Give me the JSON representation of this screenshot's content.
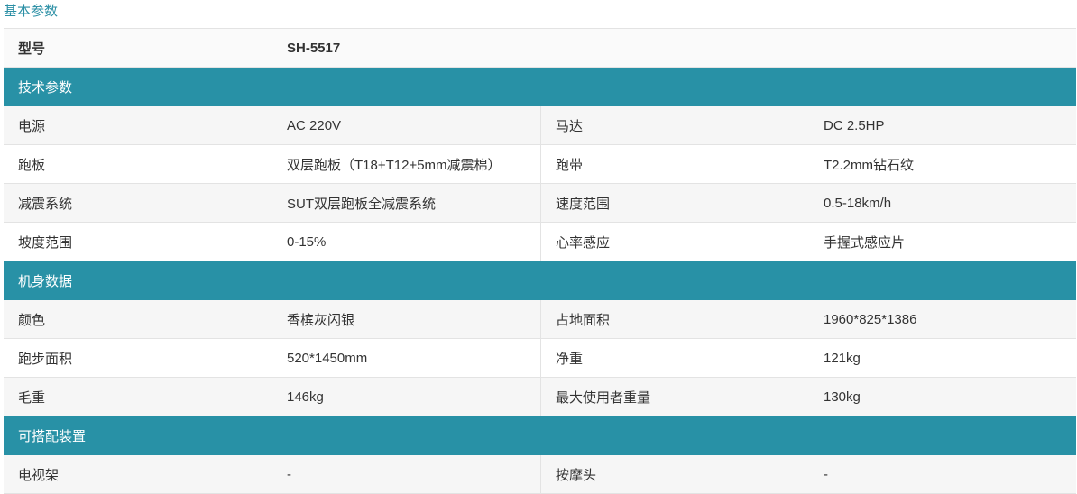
{
  "title": "基本参数",
  "model": {
    "label": "型号",
    "value": "SH-5517"
  },
  "sections": [
    {
      "heading": "技术参数",
      "rows": [
        {
          "k1": "电源",
          "v1": "AC 220V",
          "k2": "马达",
          "v2": "DC 2.5HP"
        },
        {
          "k1": "跑板",
          "v1": "双层跑板（T18+T12+5mm减震棉）",
          "k2": "跑带",
          "v2": "T2.2mm钻石纹"
        },
        {
          "k1": "减震系统",
          "v1": "SUT双层跑板全减震系统",
          "k2": "速度范围",
          "v2": "0.5-18km/h"
        },
        {
          "k1": "坡度范围",
          "v1": "0-15%",
          "k2": "心率感应",
          "v2": "手握式感应片"
        }
      ]
    },
    {
      "heading": "机身数据",
      "rows": [
        {
          "k1": "颜色",
          "v1": "香槟灰闪银",
          "k2": "占地面积",
          "v2": "1960*825*1386"
        },
        {
          "k1": "跑步面积",
          "v1": "520*1450mm",
          "k2": "净重",
          "v2": "121kg"
        },
        {
          "k1": "毛重",
          "v1": "146kg",
          "k2": "最大使用者重量",
          "v2": "130kg"
        }
      ]
    },
    {
      "heading": "可搭配装置",
      "rows": [
        {
          "k1": "电视架",
          "v1": "-",
          "k2": "按摩头",
          "v2": "-"
        }
      ]
    }
  ]
}
